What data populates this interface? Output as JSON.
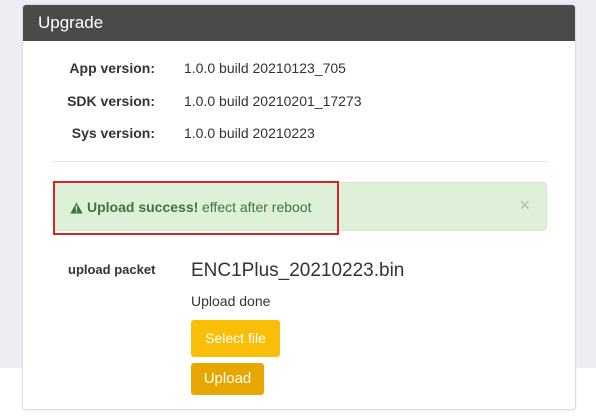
{
  "panel": {
    "title": "Upgrade"
  },
  "info": [
    {
      "label": "App version:",
      "value": "1.0.0 build 20210123_705"
    },
    {
      "label": "SDK version:",
      "value": "1.0.0 build 20210201_17273"
    },
    {
      "label": "Sys version:",
      "value": "1.0.0 build 20210223"
    }
  ],
  "alert": {
    "icon": "warning-icon",
    "strong": "Upload success!",
    "text": "effect after reboot",
    "close": "×",
    "color": "#3c763d",
    "background": "#dff0d8"
  },
  "upload": {
    "label": "upload packet",
    "filename": "ENC1Plus_20210223.bin",
    "status": "Upload done",
    "select_label": "Select file",
    "upload_label": "Upload"
  },
  "colors": {
    "header": "#4a4a4a",
    "select_button": "#f9be08",
    "upload_button": "#e8a600",
    "highlight": "#d8232a"
  }
}
